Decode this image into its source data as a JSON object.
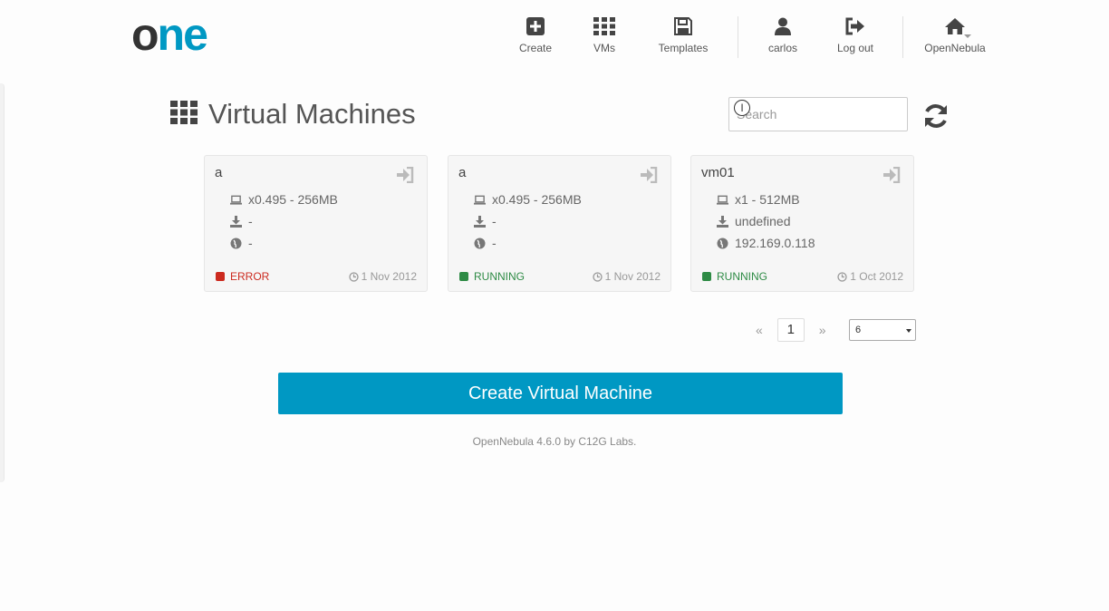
{
  "app": {
    "logo_text_1": "o",
    "logo_text_2": "ne",
    "colors": {
      "logo_dark": "#333333",
      "logo_accent": "#0098c3",
      "primary": "#0098c3",
      "error": "#cc2a1f",
      "running": "#2e8b45"
    }
  },
  "nav": {
    "create": {
      "label": "Create",
      "icon": "plus-square-icon"
    },
    "vms": {
      "label": "VMs",
      "icon": "grid-icon"
    },
    "templates": {
      "label": "Templates",
      "icon": "floppy-disk-icon"
    },
    "user": {
      "label": "carlos",
      "icon": "user-icon"
    },
    "logout": {
      "label": "Log out",
      "icon": "sign-out-icon"
    },
    "zone": {
      "label": "OpenNebula",
      "icon": "home-icon"
    }
  },
  "page": {
    "title": "Virtual Machines",
    "search_placeholder": "Search",
    "cursor_glyph": "I"
  },
  "vms": [
    {
      "name": "a",
      "capacity": "x0.495 - 256MB",
      "disk": "-",
      "ip": "-",
      "status": "ERROR",
      "status_color": "#cc2a1f",
      "date": "1 Nov 2012"
    },
    {
      "name": "a",
      "capacity": "x0.495 - 256MB",
      "disk": "-",
      "ip": "-",
      "status": "RUNNING",
      "status_color": "#2e8b45",
      "date": "1 Nov 2012"
    },
    {
      "name": "vm01",
      "capacity": "x1 - 512MB",
      "disk": "undefined",
      "ip": "192.169.0.118",
      "status": "RUNNING",
      "status_color": "#2e8b45",
      "date": "1 Oct 2012"
    }
  ],
  "pagination": {
    "prev": "«",
    "current": "1",
    "next": "»",
    "per_page": "6"
  },
  "actions": {
    "create_vm": "Create Virtual Machine"
  },
  "footer": {
    "text": "OpenNebula 4.6.0 by C12G Labs."
  }
}
